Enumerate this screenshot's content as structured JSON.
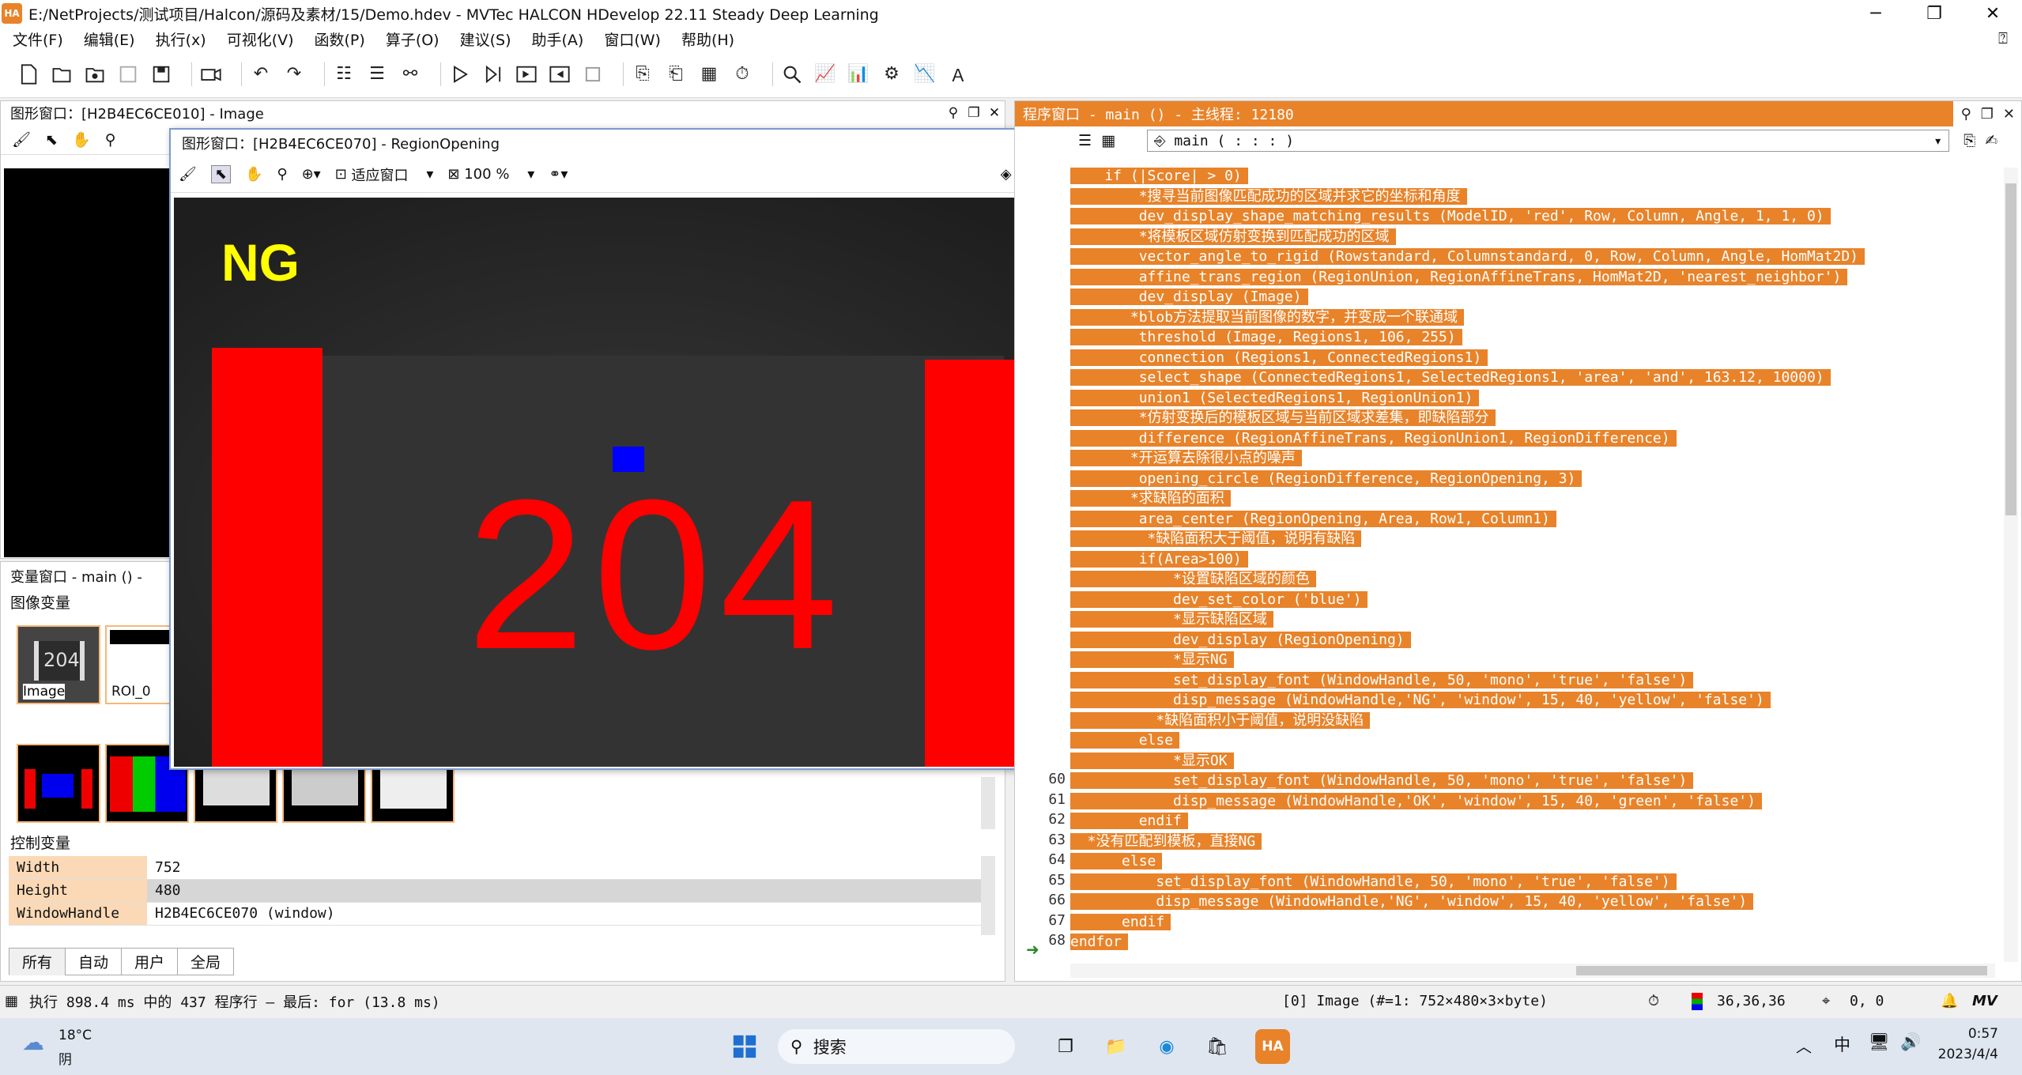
{
  "window": {
    "title": "E:/NetProjects/测试项目/Halcon/源码及素材/15/Demo.hdev - MVTec HALCON HDevelop 22.11 Steady Deep Learning",
    "app_icon": "HA"
  },
  "menu": [
    "文件(F)",
    "编辑(E)",
    "执行(x)",
    "可视化(V)",
    "函数(P)",
    "算子(O)",
    "建议(S)",
    "助手(A)",
    "窗口(W)",
    "帮助(H)"
  ],
  "graphics1": {
    "title": "图形窗口：[H2B4EC6CE010] - Image"
  },
  "graphics2": {
    "title": "图形窗口：[H2B4EC6CE070] - RegionOpening",
    "fit_label": "适应窗口",
    "zoom_label": "100 %",
    "overlay_text": "NG",
    "digits": "204",
    "overlay_color": "#ffff00",
    "region_color": "#ff0000",
    "defect_color": "#0000ff"
  },
  "variables": {
    "title": "变量窗口 - main () -",
    "iconic_header": "图像变量",
    "control_header": "控制变量",
    "thumbs": [
      {
        "label": "Image"
      },
      {
        "label": "ROI_0"
      }
    ],
    "controls": [
      {
        "name": "Width",
        "value": "752"
      },
      {
        "name": "Height",
        "value": "480"
      },
      {
        "name": "WindowHandle",
        "value": "H2B4EC6CE070 (window)"
      }
    ],
    "tabs": [
      "所有",
      "自动",
      "用户",
      "全局"
    ]
  },
  "program": {
    "title": "程序窗口 - main () - 主线程: 12180",
    "proc_selector": "main ( : : : )",
    "lines": [
      {
        "n": "",
        "t": "    if (|Score| > 0)"
      },
      {
        "n": "",
        "t": "        *搜寻当前图像匹配成功的区域并求它的坐标和角度"
      },
      {
        "n": "",
        "t": "        dev_display_shape_matching_results (ModelID, 'red', Row, Column, Angle, 1, 1, 0)"
      },
      {
        "n": "",
        "t": "        *将模板区域仿射变换到匹配成功的区域"
      },
      {
        "n": "",
        "t": "        vector_angle_to_rigid (Rowstandard, Columnstandard, 0, Row, Column, Angle, HomMat2D)"
      },
      {
        "n": "",
        "t": "        affine_trans_region (RegionUnion, RegionAffineTrans, HomMat2D, 'nearest_neighbor')"
      },
      {
        "n": "",
        "t": "        dev_display (Image)"
      },
      {
        "n": "",
        "t": "       *blob方法提取当前图像的数字，并变成一个联通域"
      },
      {
        "n": "",
        "t": "        threshold (Image, Regions1, 106, 255)"
      },
      {
        "n": "",
        "t": "        connection (Regions1, ConnectedRegions1)"
      },
      {
        "n": "",
        "t": "        select_shape (ConnectedRegions1, SelectedRegions1, 'area', 'and', 163.12, 10000)"
      },
      {
        "n": "",
        "t": "        union1 (SelectedRegions1, RegionUnion1)"
      },
      {
        "n": "",
        "t": "        *仿射变换后的模板区域与当前区域求差集，即缺陷部分"
      },
      {
        "n": "",
        "t": "        difference (RegionAffineTrans, RegionUnion1, RegionDifference)"
      },
      {
        "n": "",
        "t": "       *开运算去除很小点的噪声"
      },
      {
        "n": "",
        "t": "        opening_circle (RegionDifference, RegionOpening, 3)"
      },
      {
        "n": "",
        "t": "       *求缺陷的面积"
      },
      {
        "n": "",
        "t": "        area_center (RegionOpening, Area, Row1, Column1)"
      },
      {
        "n": "",
        "t": "         *缺陷面积大于阈值，说明有缺陷"
      },
      {
        "n": "",
        "t": "        if(Area>100)"
      },
      {
        "n": "",
        "t": "            *设置缺陷区域的颜色"
      },
      {
        "n": "",
        "t": "            dev_set_color ('blue')"
      },
      {
        "n": "",
        "t": "            *显示缺陷区域"
      },
      {
        "n": "",
        "t": "            dev_display (RegionOpening)"
      },
      {
        "n": "",
        "t": "            *显示NG"
      },
      {
        "n": "",
        "t": "            set_display_font (WindowHandle, 50, 'mono', 'true', 'false')"
      },
      {
        "n": "",
        "t": "            disp_message (WindowHandle,'NG', 'window', 15, 40, 'yellow', 'false')"
      },
      {
        "n": "",
        "t": "          *缺陷面积小于阈值，说明没缺陷"
      },
      {
        "n": "",
        "t": "        else"
      },
      {
        "n": "",
        "t": "            *显示OK"
      },
      {
        "n": "60",
        "t": "            set_display_font (WindowHandle, 50, 'mono', 'true', 'false')"
      },
      {
        "n": "61",
        "t": "            disp_message (WindowHandle,'OK', 'window', 15, 40, 'green', 'false')"
      },
      {
        "n": "62",
        "t": "        endif"
      },
      {
        "n": "63",
        "t": "  *没有匹配到模板，直接NG"
      },
      {
        "n": "64",
        "t": "      else"
      },
      {
        "n": "65",
        "t": "          set_display_font (WindowHandle, 50, 'mono', 'true', 'false')"
      },
      {
        "n": "66",
        "t": "          disp_message (WindowHandle,'NG', 'window', 15, 40, 'yellow', 'false')"
      },
      {
        "n": "67",
        "t": "      endif"
      },
      {
        "n": "68",
        "t": "endfor"
      }
    ]
  },
  "status": {
    "exec": "执行 898.4 ms 中的 437 程序行 — 最后: for (13.8 ms)",
    "image_info": "[0] Image (#=1: 752×480×3×byte)",
    "pixel": "36,36,36",
    "coords": "0, 0"
  },
  "taskbar": {
    "weather_temp": "18°C",
    "weather_desc": "阴",
    "search": "搜索",
    "ime": "中",
    "time": "0:57",
    "date": "2023/4/4"
  }
}
